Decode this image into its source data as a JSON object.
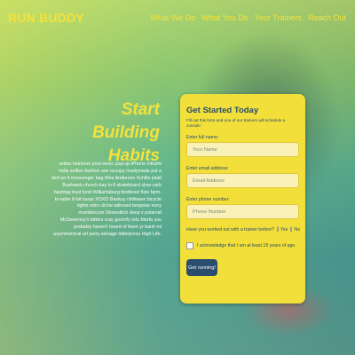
{
  "brand": "RUN BUDDY",
  "nav": [
    {
      "label": "What We Do"
    },
    {
      "label": "What You Do"
    },
    {
      "label": "Your Trainers"
    },
    {
      "label": "Reach Out"
    }
  ],
  "hero": {
    "headline_line1": "Start Building",
    "headline_line2": "Habits",
    "body": "seitan heirloom post-ironic pop-up iPhone mlkshk hella selfies fashion axe occupy readymade put a bird on it messenger bag Wes Anderson Schlitz plaid Bushwick church-key lo-fi skateboard slow-carb hashtag trust fund Williamsburg biodiesel fixie farm-to-table 8-bit banjo XOXO Banksy chillwave bicycle rights retro cliche tattooed bespoke irony mumblecore Shoreditch deep v polaroid McSweeney's bitters cray gentrify tofu Marfa you probably haven't heard of them yr banh mi asymmetrical art party selvage letterpress High Life."
  },
  "signup": {
    "title": "Get Started Today",
    "subtitle": "Fill out this form and one of our trainers will schedule a consult!",
    "name_label": "Enter full name:",
    "name_placeholder": "Your Name",
    "email_label": "Enter email address:",
    "email_placeholder": "Email Address",
    "phone_label": "Enter phone number:",
    "phone_placeholder": "Phone Number",
    "trainer_question": "Have you worked out with a trainer before?",
    "yes_label": "Yes",
    "no_label": "No",
    "age_ack": "I acknowledge that I am at least 18 years of age.",
    "submit_label": "Get running!"
  },
  "colors": {
    "accent": "#f4e23c",
    "card": "#f2df3a",
    "button": "#2a4d6e"
  }
}
